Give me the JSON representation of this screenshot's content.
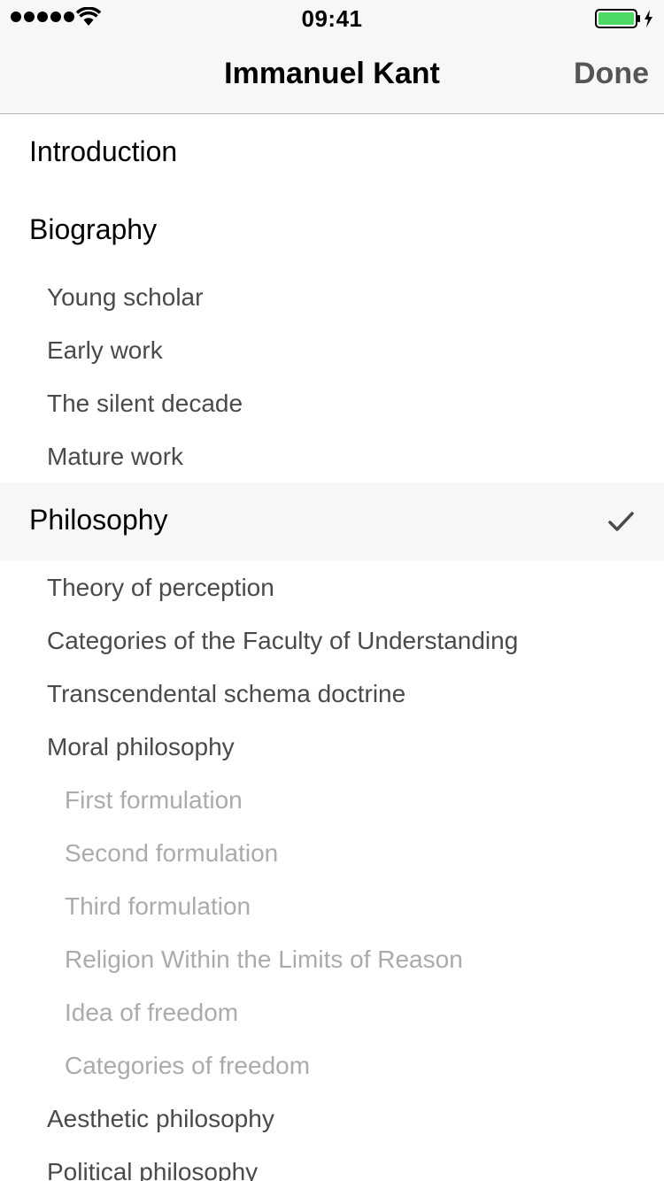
{
  "status_bar": {
    "time": "09:41",
    "signal_icon": "signal-dots-icon",
    "wifi_icon": "wifi-icon",
    "battery_icon": "battery-charging-icon",
    "battery_color": "#4cd964"
  },
  "nav": {
    "title": "Immanuel Kant",
    "done_label": "Done"
  },
  "toc": {
    "selected_icon": "checkmark-icon",
    "items": [
      {
        "label": "Introduction",
        "level": 0
      },
      {
        "label": "Biography",
        "level": 0
      },
      {
        "label": "Young scholar",
        "level": 1
      },
      {
        "label": "Early work",
        "level": 1
      },
      {
        "label": "The silent decade",
        "level": 1
      },
      {
        "label": "Mature work",
        "level": 1
      },
      {
        "label": "Philosophy",
        "level": 0,
        "selected": true
      },
      {
        "label": "Theory of perception",
        "level": 1
      },
      {
        "label": "Categories of the Faculty of Understanding",
        "level": 1
      },
      {
        "label": "Transcendental schema doctrine",
        "level": 1
      },
      {
        "label": "Moral philosophy",
        "level": 1
      },
      {
        "label": "First formulation",
        "level": 2
      },
      {
        "label": "Second formulation",
        "level": 2
      },
      {
        "label": "Third formulation",
        "level": 2
      },
      {
        "label": "Religion Within the Limits of Reason",
        "level": 2
      },
      {
        "label": "Idea of freedom",
        "level": 2
      },
      {
        "label": "Categories of freedom",
        "level": 2
      },
      {
        "label": "Aesthetic philosophy",
        "level": 1
      },
      {
        "label": "Political philosophy",
        "level": 1
      }
    ]
  }
}
